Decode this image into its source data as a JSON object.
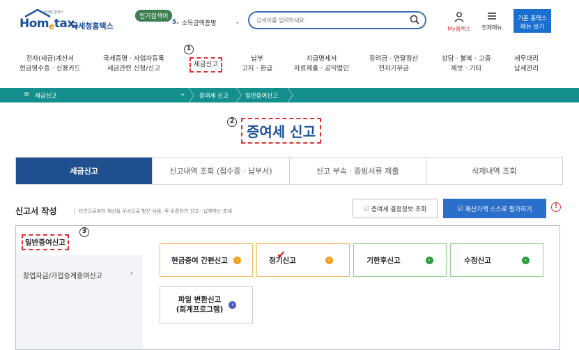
{
  "header": {
    "logo_tagline": "국세청 홈택스",
    "logo_main_1": "Hom",
    "logo_main_e": "e",
    "logo_main_2": "tax,",
    "logo_sub": "국세청홈택스",
    "popular_badge": "인기검색어",
    "popular_rank": "5.",
    "popular_term": "소득금액증명",
    "search_placeholder": "검색어를 입력하세요.",
    "my_hometax": "My홈택스",
    "all_menu": "전체메뉴",
    "old_menu_button": "기존 홈택스\n메뉴 보기"
  },
  "nav": {
    "items": [
      {
        "label": "전자(세금)계산서\n현금영수증 · 신용카드"
      },
      {
        "label": "국세증명 · 사업자등록\n세금관련 신청/신고"
      },
      {
        "label": "세금신고"
      },
      {
        "label": "납부\n고지 · 환급"
      },
      {
        "label": "지급명세서\n자료제출 · 공익법인"
      },
      {
        "label": "장려금 · 연말정산\n전자기부금"
      },
      {
        "label": "상담 · 불복 · 고충\n제보 · 기타"
      },
      {
        "label": "세무대리\n납세관리"
      }
    ]
  },
  "annotations": {
    "step1": "1",
    "step2": "2",
    "step3": "3",
    "info": "!"
  },
  "breadcrumb": {
    "menu_icon": "≡",
    "root": "세금신고",
    "chevron": "⌄",
    "level1": "증여세 신고",
    "level2": "일반증여신고"
  },
  "page_title": "증여세 신고",
  "tabs": [
    {
      "label": "세금신고",
      "active": true
    },
    {
      "label": "신고내역 조회 (접수증 · 납부서)",
      "active": false
    },
    {
      "label": "신고 부속 · 증빙서류 제출",
      "active": false
    },
    {
      "label": "삭제내역 조회",
      "active": false
    }
  ],
  "section": {
    "title": "신고서 작성",
    "description": "타인으로부터 재산을 무상으로 받은 사람, 즉 수증자가 신고 · 납부하는 조세",
    "btn_gift_info": "증여세 결정정보 조회",
    "btn_self_eval": "재산가액 스스로 평가하기"
  },
  "sidebar": {
    "active_item": "일반증여신고",
    "item2": "창업자금/가업승계증여신고",
    "chevron": "›"
  },
  "cards": {
    "c1": "현금증여 간편신고",
    "c2": "정기신고",
    "c3": "기한후신고",
    "c4": "수정신고",
    "c5": "파일 변환신고\n(회계프로그램)",
    "arrow": "›",
    "checkmark": "✔"
  },
  "colors": {
    "brand_blue": "#1c4f9c",
    "teal_bar": "#158f8d",
    "active_tab": "#1f4f8f",
    "highlight_red": "#e03030",
    "primary_button": "#2a6fc9"
  }
}
